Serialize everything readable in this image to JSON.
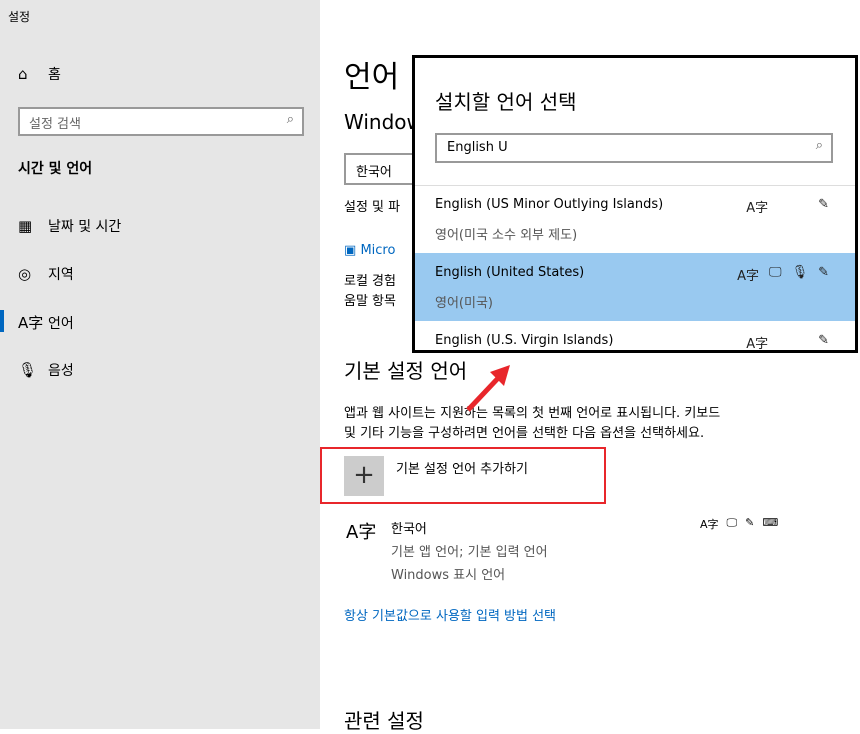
{
  "window_title": "설정",
  "sidebar": {
    "home": "홈",
    "search_placeholder": "설정 검색",
    "section": "시간 및 언어",
    "items": [
      {
        "label": "날짜 및 시간",
        "icon": "calendar-clock-icon"
      },
      {
        "label": "지역",
        "icon": "globe-region-icon"
      },
      {
        "label": "언어",
        "icon": "language-icon",
        "active": true
      },
      {
        "label": "음성",
        "icon": "microphone-icon"
      }
    ]
  },
  "main": {
    "title": "언어",
    "windows_heading": "Window",
    "display_lang": "한국어",
    "settings_text": "설정 및 파",
    "store_link": "Micro",
    "local_text1": "로컬 경험",
    "local_text2": "움말 항목",
    "pref_heading": "기본 설정 언어",
    "pref_desc1": "앱과 웹 사이트는 지원하는 목록의 첫 번째 언어로 표시됩니다. 키보드",
    "pref_desc2": "및 기타 기능을 구성하려면 언어를 선택한 다음 옵션을 선택하세요.",
    "add_label": "기본 설정 언어 추가하기",
    "lang": {
      "name": "한국어",
      "detail1": "기본 앱 언어; 기본 입력 언어",
      "detail2": "Windows 표시 언어"
    },
    "input_link": "항상 기본값으로 사용할 입력 방법 선택",
    "related": "관련 설정"
  },
  "popup": {
    "title": "설치할 언어 선택",
    "search_value": "English U",
    "items": [
      {
        "name": "English (US Minor Outlying Islands)",
        "sub": "영어(미국 소수 외부 제도)"
      },
      {
        "name": "English (United States)",
        "sub": "영어(미국)",
        "selected": true
      },
      {
        "name": "English (U.S. Virgin Islands)",
        "sub": ""
      }
    ]
  },
  "colors": {
    "accent": "#0067c0",
    "selection": "#99c9f0",
    "highlight_box": "#e8262b"
  }
}
